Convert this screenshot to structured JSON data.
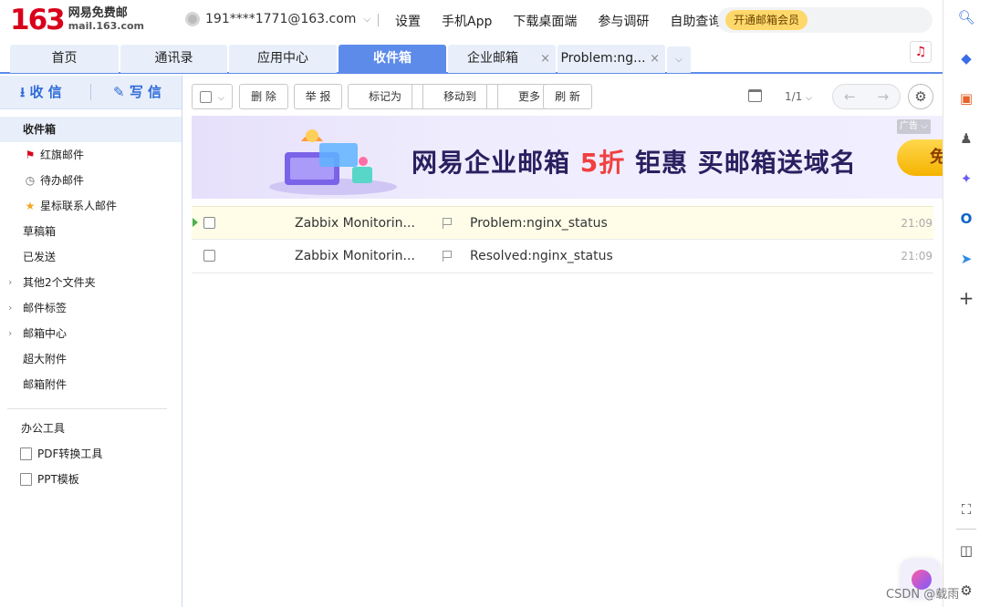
{
  "logo": {
    "number": "163",
    "name": "网易免费邮",
    "url": "mail.163.com"
  },
  "account": {
    "email": "191****1771@163.com"
  },
  "topnav": [
    "设置",
    "手机App",
    "下载桌面端",
    "参与调研",
    "自助查询"
  ],
  "vip_button": "开通邮箱会员",
  "tabs": [
    {
      "label": "首页"
    },
    {
      "label": "通讯录"
    },
    {
      "label": "应用中心"
    },
    {
      "label": "收件箱",
      "active": true
    },
    {
      "label": "企业邮箱"
    },
    {
      "label": "Problem:ng..."
    }
  ],
  "tab_close_glyph": "×",
  "compose": {
    "receive": "收 信",
    "write": "写 信"
  },
  "folders": {
    "inbox": "收件箱",
    "red_flag": "红旗邮件",
    "todo": "待办邮件",
    "starred": "星标联系人邮件",
    "drafts": "草稿箱",
    "sent": "已发送",
    "other": "其他2个文件夹",
    "labels": "邮件标签",
    "center": "邮箱中心",
    "large_attach": "超大附件",
    "mail_attach": "邮箱附件"
  },
  "tools": {
    "title": "办公工具",
    "pdf": "PDF转换工具",
    "ppt": "PPT模板"
  },
  "toolbar": {
    "delete": "删 除",
    "report": "举 报",
    "mark_as": "标记为",
    "move_to": "移动到",
    "more": "更多",
    "refresh": "刷 新"
  },
  "pager": {
    "text": "1/1"
  },
  "banner": {
    "text_a": "网易企业邮箱",
    "text_b": "5折",
    "text_c": "钜惠 买邮箱送域名",
    "ad_tag": "广告",
    "cta": "免"
  },
  "emails": [
    {
      "sender": "Zabbix Monitorin...",
      "subject": "Problem:nginx_status",
      "time": "21:09",
      "unread": true
    },
    {
      "sender": "Zabbix Monitorin...",
      "subject": "Resolved:nginx_status",
      "time": "21:09",
      "unread": false
    }
  ],
  "watermark": "CSDN @载雨",
  "colors": {
    "accent": "#5d8bea",
    "brand_red": "#d9001b",
    "vip": "#ffd86b"
  }
}
